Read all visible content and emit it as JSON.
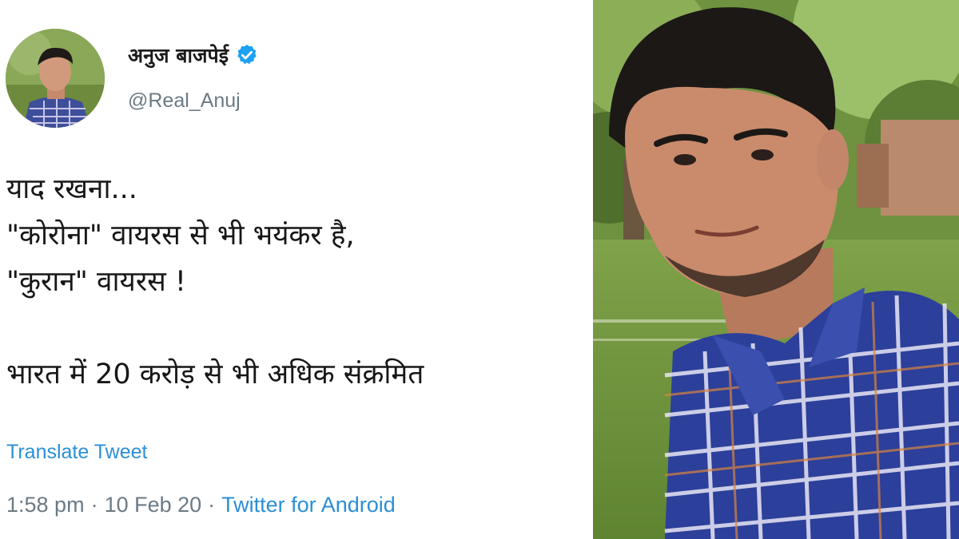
{
  "tweet": {
    "display_name": "अनुज बाजपेई",
    "handle": "@Real_Anuj",
    "body_lines": [
      "याद रखना...",
      "\"कोरोना\" वायरस से भी भयंकर है,",
      "\"कुरान\" वायरस !",
      "",
      "भारत में 20 करोड़ से भी अधिक संक्रमित"
    ],
    "translate_label": "Translate Tweet",
    "time": "1:58 pm",
    "date": "10 Feb 20",
    "source": "Twitter for Android",
    "separator": "·"
  },
  "colors": {
    "verified": "#1da1f2",
    "link": "#2b8fd6",
    "muted": "#6b7a85"
  },
  "icons": {
    "verified": "verified-badge-icon"
  }
}
